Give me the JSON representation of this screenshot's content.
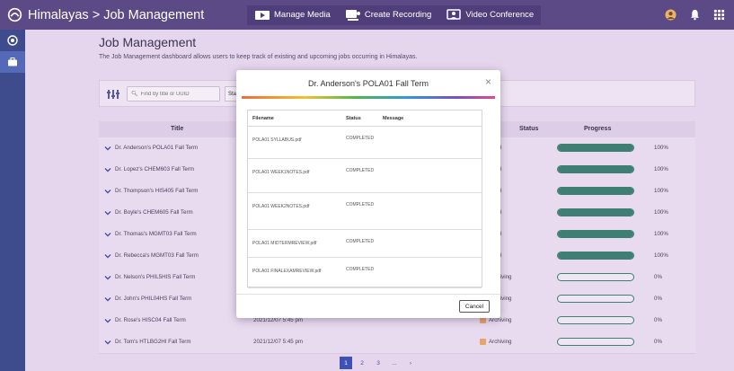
{
  "header": {
    "breadcrumb": "Himalayas > Job Management",
    "actions": [
      {
        "label": "Manage Media",
        "icon": "media-icon"
      },
      {
        "label": "Create Recording",
        "icon": "recording-icon"
      },
      {
        "label": "Video Conference",
        "icon": "video-conference-icon"
      }
    ]
  },
  "page": {
    "title": "Job Management",
    "description": "The Job Management dashboard allows users to keep track of existing and upcoming jobs occurring in Himalayas.",
    "search_placeholder": "Find by title or UUID",
    "status_filter": "Status",
    "columns": {
      "title": "Title",
      "status": "Status",
      "progress": "Progress"
    }
  },
  "rows": [
    {
      "title": "Dr. Anderson's POLA01 Fall Term",
      "date": "",
      "status": "Archived",
      "progress": 100,
      "pct": "100%"
    },
    {
      "title": "Dr. Lopez's CHEM603 Fall Term",
      "date": "",
      "status": "Archived",
      "progress": 100,
      "pct": "100%"
    },
    {
      "title": "Dr. Thompson's HIS405 Fall Term",
      "date": "",
      "status": "Archived",
      "progress": 100,
      "pct": "100%"
    },
    {
      "title": "Dr. Boyle's CHEM605 Fall Term",
      "date": "",
      "status": "Archived",
      "progress": 100,
      "pct": "100%"
    },
    {
      "title": "Dr. Thomas's MGMT03 Fall Term",
      "date": "",
      "status": "Archived",
      "progress": 100,
      "pct": "100%"
    },
    {
      "title": "Dr. Rebecca's MGMT03 Fall Term",
      "date": "",
      "status": "Archived",
      "progress": 100,
      "pct": "100%"
    },
    {
      "title": "Dr. Nelson's PHIL5HIS Fall Term",
      "date": "",
      "status": "Archiving",
      "progress": 0,
      "pct": "0%"
    },
    {
      "title": "Dr. John's PHIL04HS Fall Term",
      "date": "",
      "status": "Archiving",
      "progress": 0,
      "pct": "0%"
    },
    {
      "title": "Dr. Rose's HISC04 Fall Term",
      "date": "2021/12/07 5:45 pm",
      "status": "Archiving",
      "progress": 0,
      "pct": "0%"
    },
    {
      "title": "Dr. Tom's HTLBG2HI Fall Term",
      "date": "2021/12/07 5:45 pm",
      "status": "Archiving",
      "progress": 0,
      "pct": "0%"
    }
  ],
  "pager": [
    "1",
    "2",
    "3",
    "...",
    "›"
  ],
  "modal": {
    "title": "Dr. Anderson's POLA01 Fall Term",
    "close": "×",
    "columns": {
      "filename": "Filename",
      "status": "Status",
      "message": "Message"
    },
    "files": [
      {
        "filename": "POLA01 SYLLABUS.pdf",
        "status": "COMPLETED",
        "message": ""
      },
      {
        "filename": "POLA01 WEEK1NOTES.pdf",
        "status": "COMPLETED",
        "message": ""
      },
      {
        "filename": "POLA01 WEEK2NOTES.pdf",
        "status": "COMPLETED",
        "message": ""
      },
      {
        "filename": "POLA01 MIDTERMREVIEW.pdf",
        "status": "COMPLETED",
        "message": ""
      },
      {
        "filename": "POLA01 FINALEXAMREVIEW.pdf",
        "status": "COMPLETED",
        "message": ""
      }
    ],
    "cancel_label": "Cancel"
  },
  "colors": {
    "topbar": "#5c4a86",
    "rail": "#3e4b8c",
    "progress": "#3f7f73",
    "archiving": "#e7a56b",
    "pager_active": "#3f51b5"
  }
}
